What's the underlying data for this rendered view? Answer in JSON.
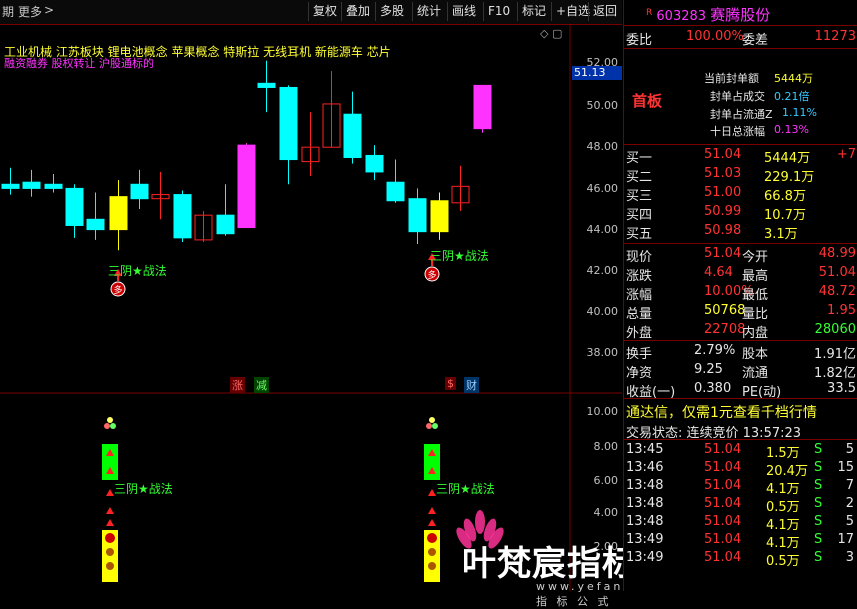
{
  "toolbar": {
    "left_text": "期",
    "more": "更多",
    "more_arrow": ">",
    "buttons": [
      "复权",
      "叠加",
      "多股",
      "统计",
      "画线",
      "F10",
      "标记",
      "+自选",
      "返回"
    ]
  },
  "chart": {
    "concepts_line1": "工业机械  江苏板块  锂电池概念 苹果概念 特斯拉 无线耳机 新能源车 芯片",
    "concepts_line2": "融资融券 股权转让 沪股通标的",
    "current_price_tag": "51.13",
    "y_ticks_main": [
      "52.00",
      "50.00",
      "48.00",
      "46.00",
      "44.00",
      "42.00",
      "40.00",
      "38.00"
    ],
    "y_ticks_sub": [
      "10.00",
      "8.00",
      "6.00",
      "4.00",
      "2.00"
    ],
    "signal_label": "三阴★战法",
    "tag_zhang": "涨",
    "tag_jian": "减",
    "tag_dollar": "$",
    "tag_cai": "财",
    "duo": "多",
    "colors": {
      "up": "#ff33ff",
      "down": "#00ffff",
      "yellow": "#ffff00",
      "red": "#ff2222",
      "green": "#00ff00"
    }
  },
  "panel": {
    "code": "603283",
    "name": "赛腾股份",
    "weibi_label": "委比",
    "weibi_value": "100.00%",
    "weicha_label": "委差",
    "weicha_value": "11273",
    "board": "首板",
    "seal_amount_label": "当前封单额",
    "seal_amount": "5444万",
    "seal_vol_label": "封单占成交",
    "seal_vol": "0.21倍",
    "seal_float_label": "封单占流通Z",
    "seal_float": "1.11%",
    "ten_day_label": "十日总涨幅",
    "ten_day": "0.13%",
    "bids": [
      {
        "label": "买一",
        "price": "51.04",
        "vol": "5444万",
        "extra": "+7"
      },
      {
        "label": "买二",
        "price": "51.03",
        "vol": "229.1万",
        "extra": ""
      },
      {
        "label": "买三",
        "price": "51.00",
        "vol": "66.8万",
        "extra": ""
      },
      {
        "label": "买四",
        "price": "50.99",
        "vol": "10.7万",
        "extra": ""
      },
      {
        "label": "买五",
        "price": "50.98",
        "vol": "3.1万",
        "extra": ""
      }
    ],
    "quote": [
      {
        "l1": "现价",
        "v1": "51.04",
        "l2": "今开",
        "v2": "48.99"
      },
      {
        "l1": "涨跌",
        "v1": "4.64",
        "l2": "最高",
        "v2": "51.04"
      },
      {
        "l1": "涨幅",
        "v1": "10.00%",
        "l2": "最低",
        "v2": "48.72"
      },
      {
        "l1": "总量",
        "v1": "50768",
        "l2": "量比",
        "v2": "1.95"
      },
      {
        "l1": "外盘",
        "v1": "22708",
        "l2": "内盘",
        "v2": "28060"
      }
    ],
    "fund": [
      {
        "l1": "换手",
        "v1": "2.79%",
        "l2": "股本",
        "v2": "1.91亿"
      },
      {
        "l1": "净资",
        "v1": "9.25",
        "l2": "流通",
        "v2": "1.82亿"
      },
      {
        "l1": "收益(一)",
        "v1": "0.380",
        "l2": "PE(动)",
        "v2": "33.5"
      }
    ],
    "promo": "通达信，仅需1元查看千档行情",
    "trade_state": "交易状态: 连续竞价 13:57:23",
    "ticks": [
      {
        "time": "13:45",
        "price": "51.04",
        "vol": "1.5万",
        "side": "S",
        "n": "5"
      },
      {
        "time": "13:46",
        "price": "51.04",
        "vol": "20.4万",
        "side": "S",
        "n": "15"
      },
      {
        "time": "13:48",
        "price": "51.04",
        "vol": "4.1万",
        "side": "S",
        "n": "7"
      },
      {
        "time": "13:48",
        "price": "51.04",
        "vol": "0.5万",
        "side": "S",
        "n": "2"
      },
      {
        "time": "13:48",
        "price": "51.04",
        "vol": "4.1万",
        "side": "S",
        "n": "5"
      },
      {
        "time": "13:49",
        "price": "51.04",
        "vol": "4.1万",
        "side": "S",
        "n": "17"
      },
      {
        "time": "13:49",
        "price": "51.04",
        "vol": "0.5万",
        "side": "S",
        "n": "3"
      }
    ]
  },
  "watermark": {
    "text": "叶梵宸指标公式网",
    "url": "www.yefanchen.com 指 标 公 式"
  }
}
